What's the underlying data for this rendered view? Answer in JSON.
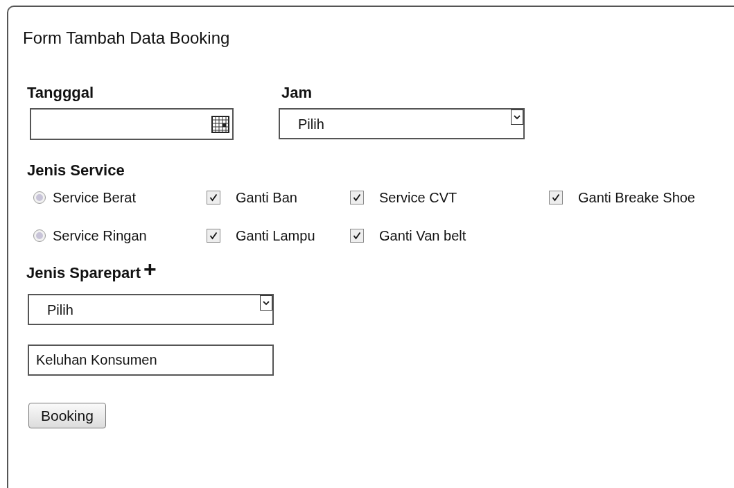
{
  "title": "Form Tambah Data Booking",
  "tanggal": {
    "label": "Tangggal"
  },
  "jam": {
    "label": "Jam",
    "value": "Pilih"
  },
  "jenis_service": {
    "label": "Jenis Service",
    "rows": [
      [
        {
          "kind": "radio",
          "label": "Service Berat",
          "selected": false
        },
        {
          "kind": "checkbox",
          "label": "Ganti Ban",
          "checked": true
        },
        {
          "kind": "checkbox",
          "label": "Service CVT",
          "checked": true
        },
        {
          "kind": "checkbox",
          "label": "Ganti Breake Shoe",
          "checked": true
        }
      ],
      [
        {
          "kind": "radio",
          "label": "Service Ringan",
          "selected": false
        },
        {
          "kind": "checkbox",
          "label": "Ganti Lampu",
          "checked": true
        },
        {
          "kind": "checkbox",
          "label": "Ganti Van belt",
          "checked": true
        }
      ]
    ]
  },
  "jenis_sparepart": {
    "label": "Jenis Sparepart",
    "add": "+",
    "value": "Pilih"
  },
  "keluhan": {
    "value": "Keluhan Konsumen"
  },
  "button": "Booking"
}
